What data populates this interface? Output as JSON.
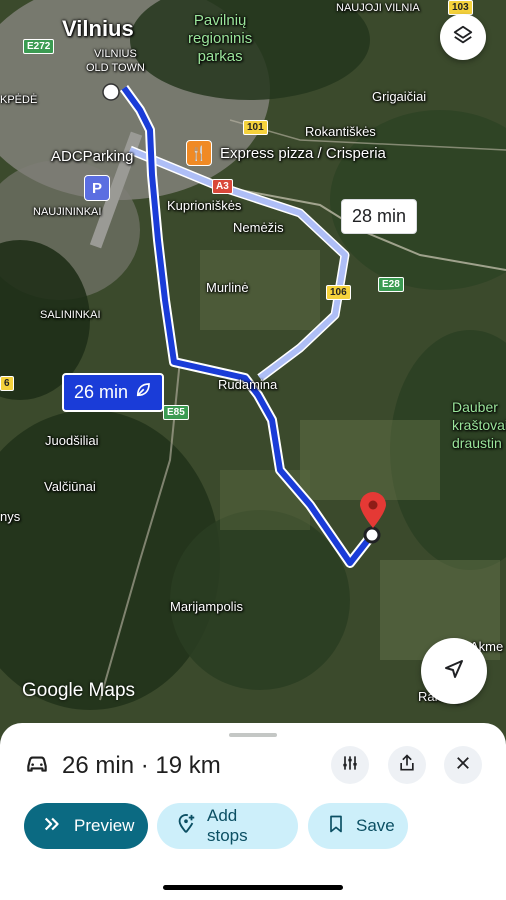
{
  "map": {
    "places": {
      "vilnius": "Vilnius",
      "old_town": "VILNIUS\nOLD TOWN",
      "pavilniu": "Pavilnių\nregioninis\nparkas",
      "naujoji_vilnia": "NAUJOJI VILNIA",
      "grigaiciai": "Grigaičiai",
      "rokantiskes": "Rokantiškės",
      "adc_parking": "ADCParking",
      "express_pizza": "Express pizza / Crisperia",
      "naujininkai": "NAUJININKAI",
      "kuprioniskes": "Kuprioniškės",
      "nemezis": "Nemėžis",
      "murline": "Murlinė",
      "salininkai": "SALININKAI",
      "rudamina": "Rudamina",
      "juodsiliai": "Juodšiliai",
      "valciunai": "Valčiūnai",
      "nys": "nys",
      "dauber": "Dauber\nkraštovaiz\ndraustin",
      "marijampolis": "Marijampolis",
      "akme": "Akme",
      "rakony": "Rakony",
      "kpede": "KPĖDĖ"
    },
    "roads": {
      "e272": "E272",
      "r103": "103",
      "r101": "101",
      "a3": "A3",
      "e28": "E28",
      "r106": "106",
      "e85": "E85",
      "r6": "6"
    },
    "alt_route_eta": "28 min",
    "main_route_eta": "26 min",
    "logo": "Google Maps",
    "colors": {
      "main_route": "#1a3cd8",
      "alt_route": "#aebef6",
      "destination_pin": "#e53935"
    }
  },
  "sheet": {
    "summary": "26 min · 19 km",
    "preview_label": "Preview",
    "add_stops_label": "Add stops",
    "save_label": "Save"
  },
  "icons": [
    "layers-icon",
    "navigate-arrow-icon",
    "car-icon",
    "route-options-icon",
    "share-icon",
    "close-icon",
    "fast-forward-icon",
    "add-location-icon",
    "bookmark-icon",
    "leaf-icon",
    "parking-icon",
    "restaurant-icon"
  ]
}
